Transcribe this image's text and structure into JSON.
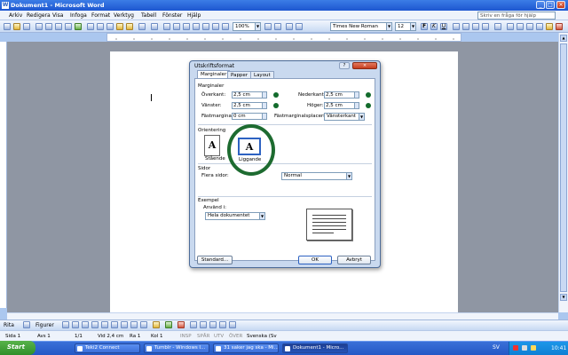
{
  "window": {
    "title": "Dokument1 - Microsoft Word"
  },
  "menu": [
    "Arkiv",
    "Redigera",
    "Visa",
    "Infoga",
    "Format",
    "Verktyg",
    "Tabell",
    "Fönster",
    "Hjälp"
  ],
  "help_placeholder": "Skriv en fråga för hjälp",
  "toolbar": {
    "zoom": "100%",
    "font": "Times New Roman",
    "size": "12"
  },
  "dialog": {
    "title": "Utskriftsformat",
    "tabs": [
      "Marginaler",
      "Papper",
      "Layout"
    ],
    "margins": {
      "group": "Marginaler",
      "top_label": "Överkant:",
      "top_value": "2,5 cm",
      "bottom_label": "Nederkant:",
      "bottom_value": "2,5 cm",
      "left_label": "Vänster:",
      "left_value": "2,5 cm",
      "right_label": "Höger:",
      "right_value": "2,5 cm",
      "gutter_label": "Fästmarginal:",
      "gutter_value": "0 cm",
      "gutterpos_label": "Fästmarginalsplacering:",
      "gutterpos_value": "Vänsterkant"
    },
    "orientation": {
      "group": "Orientering",
      "portrait": "Stående",
      "landscape": "Liggande"
    },
    "pages": {
      "group": "Sidor",
      "multiple_label": "Flera sidor:",
      "multiple_value": "Normal"
    },
    "example": {
      "group": "Exempel",
      "apply_label": "Använd i:",
      "apply_value": "Hela dokumentet"
    },
    "buttons": {
      "default": "Standard...",
      "ok": "OK",
      "cancel": "Avbryt"
    }
  },
  "draw": {
    "label": "Rita",
    "figures": "Figurer"
  },
  "status": {
    "page": "Sida 1",
    "section": "Avs 1",
    "pages": "1/1",
    "at": "Vid 2,4 cm",
    "line": "Ra 1",
    "col": "Kol 1",
    "rec": "INSP",
    "trk": "SPÅR",
    "ext": "UTV",
    "ovr": "ÖVER",
    "lang": "Svenska (Sv"
  },
  "taskbar": {
    "start": "Start",
    "tasks": [
      "Teki2 Connect",
      "Tumblr - Windows I...",
      "31 saker jag ska - Mi...",
      "Dokument1 - Micro..."
    ],
    "tray_lang": "SV",
    "clock": "10:41"
  },
  "icons": [
    "new-icon",
    "open-icon",
    "save-icon",
    "print-icon",
    "undo-icon",
    "redo-icon",
    "table-icon",
    "help-icon",
    "bold-icon",
    "italic-icon",
    "underline-icon",
    "align-icon",
    "bullets-icon",
    "indent-icon",
    "font-color-icon"
  ]
}
